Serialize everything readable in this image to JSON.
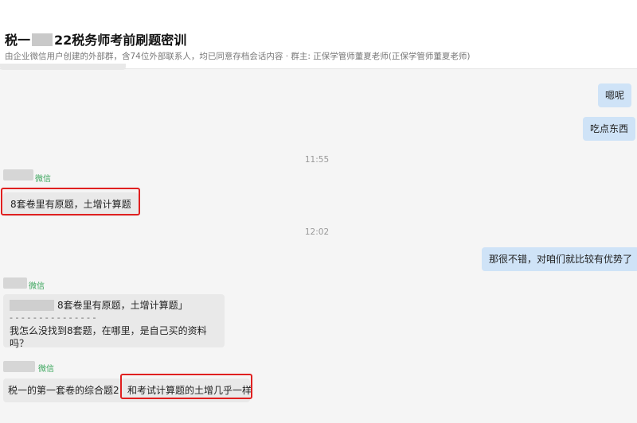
{
  "header": {
    "title_prefix": "税一",
    "title_suffix": "22税务师考前刷题密训",
    "subtitle": "由企业微信用户创建的外部群，含74位外部联系人，均已同意存档会话内容 · 群主: 正保学管师董夏老师(正保学管师董夏老师)"
  },
  "messages": {
    "m1": "嗯呢",
    "m2": "吃点东西",
    "t1": "11:55",
    "s1": "微信",
    "m3": "8套卷里有原题，土增计算题",
    "t2": "12:02",
    "m4": "那很不错，对咱们就比较有优势了",
    "s2": "微信",
    "m5_quote": "8套卷里有原题，土增计算题」",
    "m5_sep": "- - - - - - - - - - - - - - -",
    "m5_text": "我怎么没找到8套题，在哪里，是自己买的资料吗？",
    "s3": "微信",
    "m6": "税一的第一套卷的综合题2",
    "m7": "和考试计算题的土增几乎一样"
  },
  "colors": {
    "outgoing_bubble": "#cfe3f7",
    "incoming_bubble": "#e9e9e9",
    "sender_label": "#3aa55c",
    "highlight_box": "#e02020"
  }
}
